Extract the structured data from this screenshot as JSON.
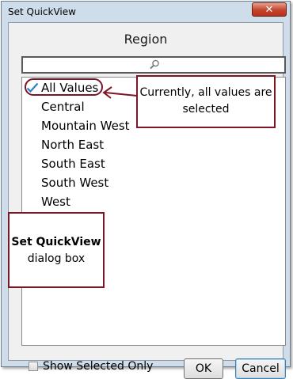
{
  "window": {
    "title": "Set QuickView",
    "close_icon": "close-icon"
  },
  "panel": {
    "header": "Region"
  },
  "search": {
    "icon": "magnifier-icon",
    "value": ""
  },
  "list": {
    "items": [
      {
        "label": "All Values",
        "checked": true
      },
      {
        "label": "Central"
      },
      {
        "label": "Mountain West"
      },
      {
        "label": "North East"
      },
      {
        "label": "South East"
      },
      {
        "label": "South West"
      },
      {
        "label": "West"
      }
    ]
  },
  "footer": {
    "show_selected_label": "Show Selected Only",
    "show_selected_checked": false,
    "ok_label": "OK",
    "cancel_label": "Cancel"
  },
  "annotations": {
    "callout_values": "Currently, all values are selected",
    "callout_dialog_title": "Set QuickView",
    "callout_dialog_sub": "dialog box"
  },
  "colors": {
    "annotation": "#7b1624",
    "check": "#2f7fd1",
    "window_frame": "#cfdcea"
  }
}
